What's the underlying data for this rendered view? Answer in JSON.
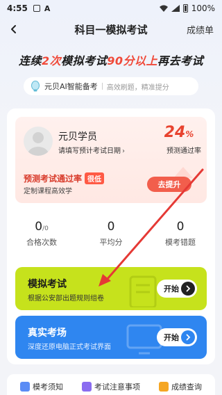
{
  "status_bar": {
    "time": "4:55",
    "battery": "100%"
  },
  "nav": {
    "title": "科目一模拟考试",
    "right": "成绩单"
  },
  "headline": {
    "p1": "连续",
    "h1": "2次",
    "p2": "模拟考试",
    "h2": "90分以上",
    "p3": "再去考试"
  },
  "ai": {
    "title": "元贝AI智能备考",
    "subtitle": "高效刷题，精准提分"
  },
  "user": {
    "name": "元贝学员",
    "date_prompt": "请填写预计考试日期",
    "percent": "24",
    "percent_sign": "%",
    "percent_label": "预测通过率",
    "predict_title": "预测考试通过率",
    "predict_badge": "很低",
    "predict_sub": "定制课程高效学",
    "improve_button": "去提升"
  },
  "stats": [
    {
      "value": "0",
      "suffix": "/0",
      "label": "合格次数"
    },
    {
      "value": "0",
      "suffix": "",
      "label": "平均分"
    },
    {
      "value": "0",
      "suffix": "",
      "label": "模考错题"
    }
  ],
  "mock_exam": {
    "title": "模拟考试",
    "subtitle": "根据公安部出题规则组卷",
    "button": "开始"
  },
  "real_exam": {
    "title": "真实考场",
    "subtitle": "深度还原电脑正式考试界面",
    "button": "开始"
  },
  "bottom_tabs": [
    {
      "label": "模考须知",
      "color": "#5b8cf5"
    },
    {
      "label": "考试注意事项",
      "color": "#8a6cf0"
    },
    {
      "label": "成绩查询",
      "color": "#f5a623"
    }
  ],
  "colors": {
    "accent_red": "#f04a3a",
    "mock_green": "#c6e21c",
    "real_blue": "#2f86f0"
  }
}
